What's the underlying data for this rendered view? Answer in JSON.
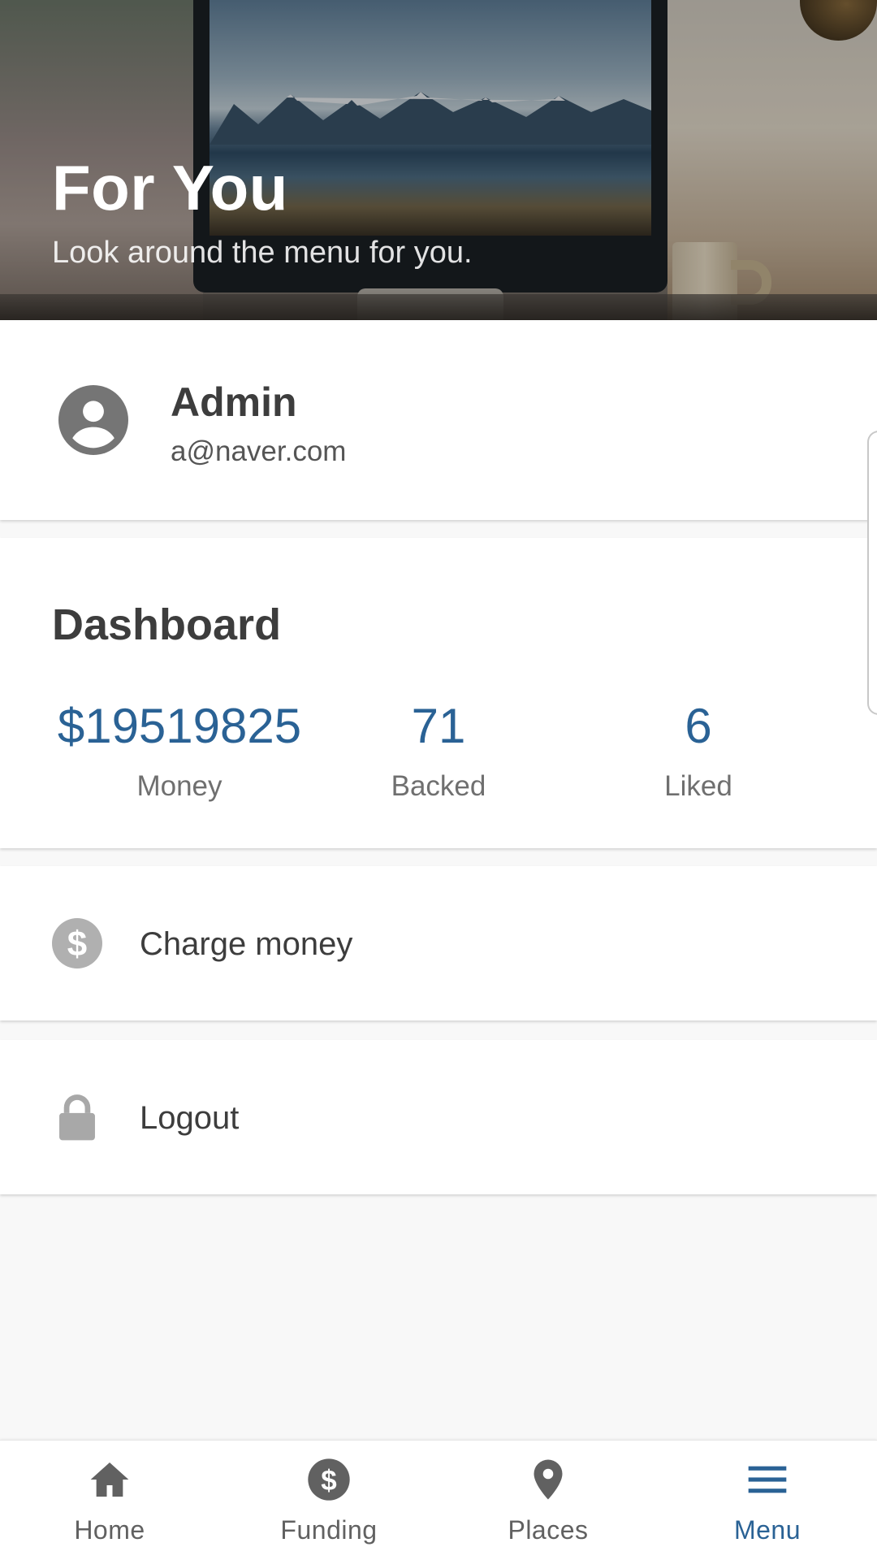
{
  "header": {
    "title": "For You",
    "subtitle": "Look around the menu for you."
  },
  "profile": {
    "name": "Admin",
    "email": "a@naver.com",
    "icon": "account-circle-icon"
  },
  "dashboard": {
    "title": "Dashboard",
    "stats": [
      {
        "value": "$19519825",
        "label": "Money"
      },
      {
        "value": "71",
        "label": "Backed"
      },
      {
        "value": "6",
        "label": "Liked"
      }
    ]
  },
  "menu": {
    "charge_label": "Charge money",
    "charge_icon": "dollar-circle-icon",
    "logout_label": "Logout",
    "logout_icon": "lock-icon"
  },
  "bottom_nav": {
    "items": [
      {
        "label": "Home",
        "icon": "home-icon"
      },
      {
        "label": "Funding",
        "icon": "dollar-circle-icon"
      },
      {
        "label": "Places",
        "icon": "location-pin-icon"
      },
      {
        "label": "Menu",
        "icon": "menu-icon",
        "active": true
      }
    ]
  },
  "colors": {
    "accent": "#2a6295",
    "icon_gray": "#757575",
    "background": "#f8f8f8"
  }
}
